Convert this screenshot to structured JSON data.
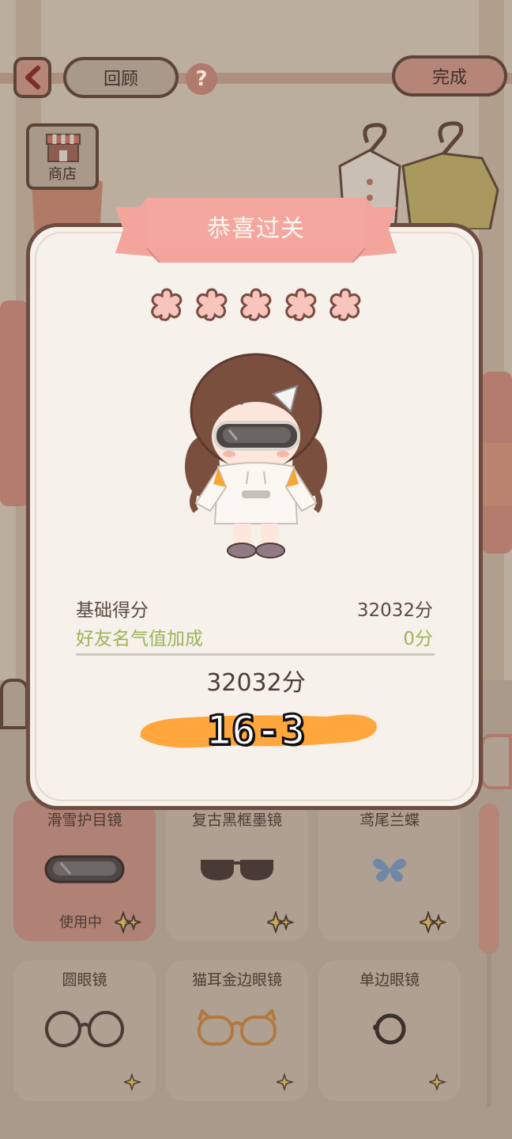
{
  "top_bar": {
    "review_label": "回顾",
    "help_symbol": "?",
    "done_label": "完成",
    "back_icon": "chevron-left-icon"
  },
  "shop": {
    "label": "商店",
    "icon": "shop-awning-icon"
  },
  "modal": {
    "title": "恭喜过关",
    "stars_total": 5,
    "stars_earned": 5,
    "base_score_label": "基础得分",
    "base_score_value": "32032分",
    "bonus_label": "好友名气值加成",
    "bonus_value": "0分",
    "total_score": "32032分",
    "level_label": "16-3"
  },
  "items": [
    {
      "name": "滑雪护目镜",
      "status": "使用中",
      "icon": "ski-goggles-icon",
      "active": true
    },
    {
      "name": "复古黑框墨镜",
      "status": "",
      "icon": "sunglasses-icon",
      "active": false
    },
    {
      "name": "鸢尾兰蝶",
      "status": "",
      "icon": "butterfly-icon",
      "active": false
    },
    {
      "name": "圆眼镜",
      "status": "",
      "icon": "round-glasses-icon",
      "active": false
    },
    {
      "name": "猫耳金边眼镜",
      "status": "",
      "icon": "cat-ear-glasses-icon",
      "active": false
    },
    {
      "name": "单边眼镜",
      "status": "",
      "icon": "monocle-icon",
      "active": false
    }
  ],
  "colors": {
    "modal_bg": "#f6f1ea",
    "ribbon": "#f3a49b",
    "star_fill": "#f7c5bb",
    "star_outline": "#7b4d42",
    "bonus_green": "#9ab55a",
    "level_highlight": "#ffa63d",
    "dim_overlay": "#b5a89a"
  }
}
